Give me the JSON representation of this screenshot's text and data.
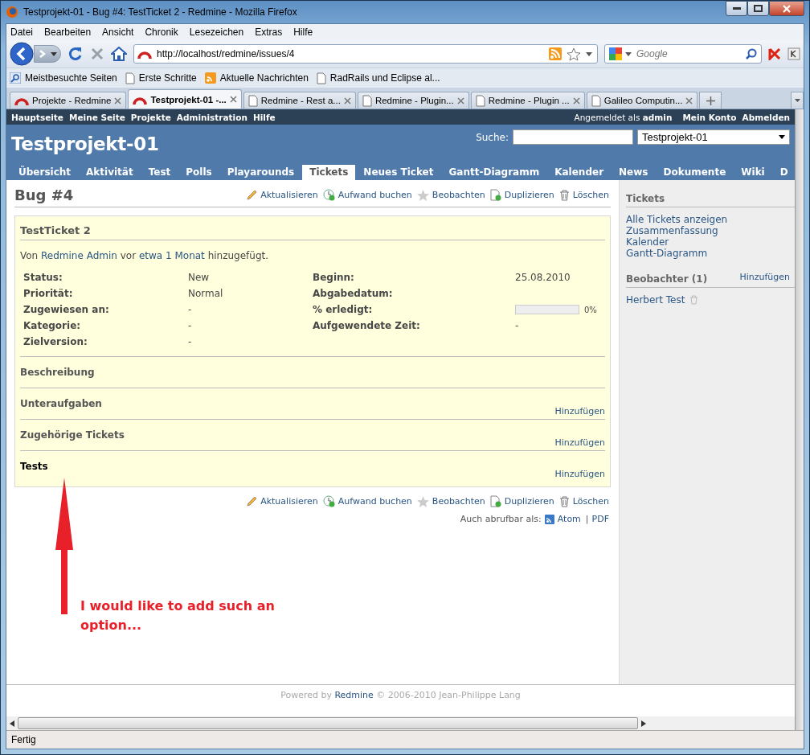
{
  "window": {
    "title": "Testprojekt-01 - Bug #4: TestTicket 2 - Redmine - Mozilla Firefox"
  },
  "menu": [
    "Datei",
    "Bearbeiten",
    "Ansicht",
    "Chronik",
    "Lesezeichen",
    "Extras",
    "Hilfe"
  ],
  "address": {
    "value": "http://localhost/redmine/issues/4"
  },
  "search": {
    "placeholder": "Google"
  },
  "bookmarks": [
    {
      "label": "Meistbesuchte Seiten",
      "kind": "search"
    },
    {
      "label": "Erste Schritte",
      "kind": "page"
    },
    {
      "label": "Aktuelle Nachrichten",
      "kind": "feed"
    },
    {
      "label": "RadRails und Eclipse al...",
      "kind": "page"
    }
  ],
  "tabs": [
    {
      "label": "Projekte - Redmine",
      "selected": false,
      "kind": "redmine"
    },
    {
      "label": "Testprojekt-01 -...",
      "selected": true,
      "kind": "redmine"
    },
    {
      "label": "Redmine - Rest a...",
      "selected": false,
      "kind": "page"
    },
    {
      "label": "Redmine - Plugin...",
      "selected": false,
      "kind": "page"
    },
    {
      "label": "Redmine - Plugin ...",
      "selected": false,
      "kind": "page"
    },
    {
      "label": "Galileo Computin...",
      "selected": false,
      "kind": "page"
    }
  ],
  "page": {
    "top_menu": [
      "Hauptseite",
      "Meine Seite",
      "Projekte",
      "Administration",
      "Hilfe"
    ],
    "logged_in": {
      "prefix": "Angemeldet als",
      "user": "admin"
    },
    "account_links": [
      "Mein Konto",
      "Abmelden"
    ],
    "project_title": "Testprojekt-01",
    "search_label": "Suche:",
    "project_select": "Testprojekt-01",
    "main_menu": [
      {
        "label": "Übersicht",
        "selected": false
      },
      {
        "label": "Aktivität",
        "selected": false
      },
      {
        "label": "Test",
        "selected": false
      },
      {
        "label": "Polls",
        "selected": false
      },
      {
        "label": "Playarounds",
        "selected": false
      },
      {
        "label": "Tickets",
        "selected": true
      },
      {
        "label": "Neues Ticket",
        "selected": false
      },
      {
        "label": "Gantt-Diagramm",
        "selected": false
      },
      {
        "label": "Kalender",
        "selected": false
      },
      {
        "label": "News",
        "selected": false
      },
      {
        "label": "Dokumente",
        "selected": false
      },
      {
        "label": "Wiki",
        "selected": false
      },
      {
        "label": "D",
        "selected": false
      }
    ],
    "issue_title": "Bug #4",
    "actions_top": [
      {
        "label": "Aktualisieren",
        "kind": "edit"
      },
      {
        "label": "Aufwand buchen",
        "kind": "time"
      },
      {
        "label": "Beobachten",
        "kind": "watch"
      },
      {
        "label": "Duplizieren",
        "kind": "copy"
      },
      {
        "label": "Löschen",
        "kind": "delete"
      }
    ],
    "subject": "TestTicket 2",
    "author_line": {
      "prefix": "Von",
      "author": "Redmine Admin",
      "middle": "vor",
      "age": "etwa 1 Monat",
      "suffix": "hinzugefügt."
    },
    "attributes_left": [
      {
        "label": "Status:",
        "value": "New"
      },
      {
        "label": "Priorität:",
        "value": "Normal"
      },
      {
        "label": "Zugewiesen an:",
        "value": "-"
      },
      {
        "label": "Kategorie:",
        "value": "-"
      },
      {
        "label": "Zielversion:",
        "value": "-"
      }
    ],
    "attributes_right": [
      {
        "label": "Beginn:",
        "kind": "text",
        "value": "25.08.2010"
      },
      {
        "label": "Abgabedatum:",
        "kind": "text"
      },
      {
        "label": "% erledigt:",
        "kind": "progress",
        "level": 0,
        "value": "0%"
      },
      {
        "label": "Aufgewendete Zeit:",
        "kind": "text",
        "value": "-"
      }
    ],
    "sections": [
      {
        "title": "Beschreibung",
        "emphasized": false
      },
      {
        "title": "Unteraufgaben",
        "action": "Hinzufügen",
        "emphasized": false
      },
      {
        "title": "Zugehörige Tickets",
        "action": "Hinzufügen",
        "emphasized": false
      },
      {
        "title": "Tests",
        "action": "Hinzufügen",
        "emphasized": true
      }
    ],
    "actions_bottom": [
      {
        "label": "Aktualisieren",
        "kind": "edit"
      },
      {
        "label": "Aufwand buchen",
        "kind": "time"
      },
      {
        "label": "Beobachten",
        "kind": "watch"
      },
      {
        "label": "Duplizieren",
        "kind": "copy"
      },
      {
        "label": "Löschen",
        "kind": "delete"
      }
    ],
    "formats": {
      "label": "Auch abrufbar als:",
      "links": [
        {
          "label": "Atom",
          "kind": "feed"
        },
        {
          "label": "PDF",
          "kind": "plain"
        }
      ],
      "separator": "|"
    },
    "sidebar": {
      "heading": "Tickets",
      "links": [
        "Alle Tickets anzeigen",
        "Zusammenfassung",
        "Kalender",
        "Gantt-Diagramm"
      ],
      "watchers_heading": "Beobachter (1)",
      "watchers_action": "Hinzufügen",
      "watchers": [
        "Herbert Test"
      ]
    },
    "footer": {
      "prefix": "Powered by",
      "link": "Redmine",
      "suffix": "© 2006-2010 Jean-Philippe Lang"
    }
  },
  "annotation": {
    "text": "I would like to add such an option..."
  },
  "status_bar": "Fertig"
}
